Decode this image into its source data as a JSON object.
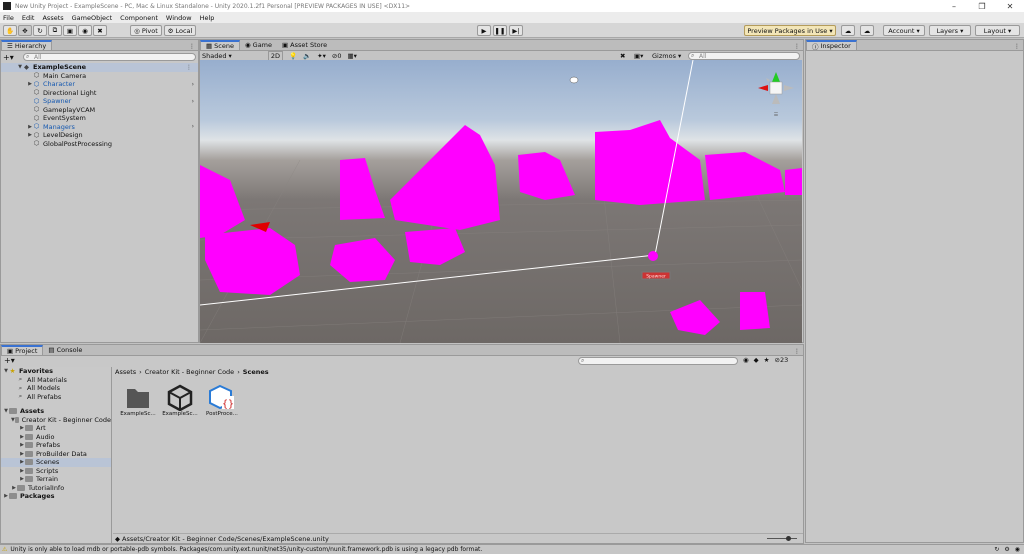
{
  "window": {
    "title": "New Unity Project - ExampleScene - PC, Mac & Linux Standalone - Unity 2020.1.2f1 Personal [PREVIEW PACKAGES IN USE] <DX11>",
    "minimize": "–",
    "maximize": "❐",
    "close": "✕"
  },
  "menu": [
    "File",
    "Edit",
    "Assets",
    "GameObject",
    "Component",
    "Window",
    "Help"
  ],
  "toolbar": {
    "pivot": "Pivot",
    "local": "Local",
    "preview_packages": "Preview Packages in Use",
    "account": "Account",
    "layers": "Layers",
    "layout": "Layout"
  },
  "hierarchy": {
    "tab": "Hierarchy",
    "search_placeholder": "All",
    "scene": "ExampleScene",
    "items": [
      {
        "label": "Main Camera",
        "prefab": false,
        "expandable": false,
        "arrow": false
      },
      {
        "label": "Character",
        "prefab": true,
        "expandable": true,
        "arrow": true
      },
      {
        "label": "Directional Light",
        "prefab": false,
        "expandable": false,
        "arrow": false
      },
      {
        "label": "Spawner",
        "prefab": true,
        "expandable": false,
        "arrow": true
      },
      {
        "label": "GameplayVCAM",
        "prefab": false,
        "expandable": false,
        "arrow": false
      },
      {
        "label": "EventSystem",
        "prefab": false,
        "expandable": false,
        "arrow": false
      },
      {
        "label": "Managers",
        "prefab": true,
        "expandable": true,
        "arrow": true
      },
      {
        "label": "LevelDesign",
        "prefab": false,
        "expandable": true,
        "arrow": false
      },
      {
        "label": "GlobalPostProcessing",
        "prefab": false,
        "expandable": false,
        "arrow": false
      }
    ]
  },
  "scene": {
    "tabs": [
      "Scene",
      "Game",
      "Asset Store"
    ],
    "shading": "Shaded",
    "mode2d": "2D",
    "hidden_count": "0",
    "gizmos": "Gizmos",
    "search_placeholder": "All",
    "label_tag": "Spawner",
    "colors": {
      "missing_material": "#ff00ff",
      "sky": "#9db2cf",
      "ground": "#6d6865"
    }
  },
  "inspector": {
    "tab": "Inspector"
  },
  "project": {
    "tabs": [
      "Project",
      "Console"
    ],
    "favorites_title": "Favorites",
    "favorites": [
      "All Materials",
      "All Models",
      "All Prefabs"
    ],
    "assets_title": "Assets",
    "tree": [
      {
        "label": "Creator Kit - Beginner Code",
        "level": 1,
        "expanded": true
      },
      {
        "label": "Art",
        "level": 2,
        "expanded": false
      },
      {
        "label": "Audio",
        "level": 2,
        "expanded": false
      },
      {
        "label": "Prefabs",
        "level": 2,
        "expanded": false
      },
      {
        "label": "ProBuilder Data",
        "level": 2,
        "expanded": false
      },
      {
        "label": "Scenes",
        "level": 2,
        "expanded": false,
        "selected": true
      },
      {
        "label": "Scripts",
        "level": 2,
        "expanded": false
      },
      {
        "label": "Terrain",
        "level": 2,
        "expanded": false
      },
      {
        "label": "TutorialInfo",
        "level": 1,
        "expanded": false
      }
    ],
    "packages_title": "Packages",
    "breadcrumb": [
      "Assets",
      "Creator Kit - Beginner Code",
      "Scenes"
    ],
    "hidden_count": "23",
    "assets": [
      {
        "label": "ExampleSc...",
        "icon": "folder-icon"
      },
      {
        "label": "ExampleSc...",
        "icon": "unity-scene-icon"
      },
      {
        "label": "PostProce...",
        "icon": "post-process-profile-icon"
      }
    ],
    "path": "Assets/Creator Kit - Beginner Code/Scenes/ExampleScene.unity"
  },
  "status": {
    "message": "Unity is only able to load mdb or portable-pdb symbols. Packages/com.unity.ext.nunit/net35/unity-custom/nunit.framework.pdb is using a legacy pdb format."
  }
}
